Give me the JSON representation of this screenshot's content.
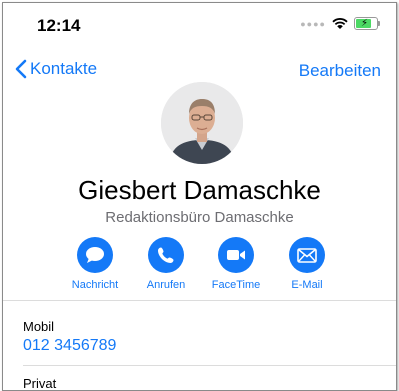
{
  "status_bar": {
    "time": "12:14",
    "battery_level": 0.75
  },
  "nav": {
    "back_label": "Kontakte",
    "edit_label": "Bearbeiten"
  },
  "contact": {
    "name": "Giesbert Damaschke",
    "company": "Redaktionsbüro Damaschke"
  },
  "actions": [
    {
      "label": "Nachricht",
      "icon": "message-icon"
    },
    {
      "label": "Anrufen",
      "icon": "phone-icon"
    },
    {
      "label": "FaceTime",
      "icon": "video-icon"
    },
    {
      "label": "E-Mail",
      "icon": "mail-icon"
    }
  ],
  "fields": [
    {
      "label": "Mobil",
      "value": "012 3456789"
    },
    {
      "label": "Privat"
    }
  ],
  "colors": {
    "accent": "#1479f7",
    "secondary_text": "#6d6d72",
    "separator": "#dcdcdc",
    "battery": "#4cd964"
  }
}
